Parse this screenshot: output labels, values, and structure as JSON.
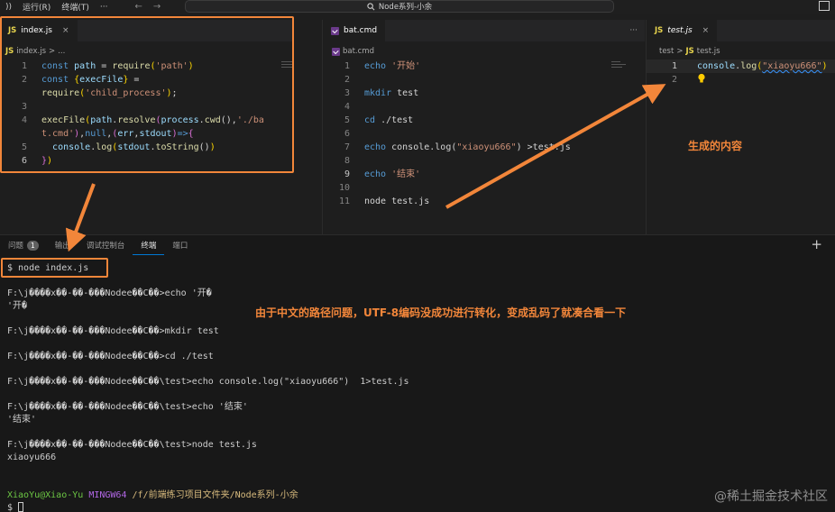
{
  "titlebar": {
    "menu": [
      "))",
      "运行(R)",
      "终端(T)",
      "···"
    ],
    "nav_back": "←",
    "nav_forward": "→",
    "search": "Node系列-小余"
  },
  "editor_left": {
    "tab_label": "index.js",
    "tab_icon": "JS",
    "tab_close": "×",
    "crumb": [
      "index.js",
      "..."
    ],
    "lines": [
      {
        "n": "1",
        "code": "const path = require('path')"
      },
      {
        "n": "2",
        "code": "const {execFile} ="
      },
      {
        "n": "",
        "code": "require('child_process');"
      },
      {
        "n": "3",
        "code": ""
      },
      {
        "n": "4",
        "code": "execFile(path.resolve(process.cwd(),'./ba"
      },
      {
        "n": "",
        "code": "t.cmd'),null,(err,stdout)=>{"
      },
      {
        "n": "5",
        "code": "  console.log(stdout.toString())"
      },
      {
        "n": "6",
        "code": "})"
      }
    ]
  },
  "editor_middle": {
    "tab_label": "bat.cmd",
    "crumb": [
      "bat.cmd"
    ],
    "actions": [
      "···"
    ],
    "lines": [
      {
        "n": "1",
        "code": "echo '开始'"
      },
      {
        "n": "2",
        "code": ""
      },
      {
        "n": "3",
        "code": "mkdir test"
      },
      {
        "n": "4",
        "code": ""
      },
      {
        "n": "5",
        "code": "cd ./test"
      },
      {
        "n": "6",
        "code": ""
      },
      {
        "n": "7",
        "code": "echo console.log(\"xiaoyu666\") >test.js"
      },
      {
        "n": "8",
        "code": ""
      },
      {
        "n": "9",
        "code": "echo '结束'"
      },
      {
        "n": "10",
        "code": ""
      },
      {
        "n": "11",
        "code": "node test.js"
      }
    ]
  },
  "editor_right": {
    "tab_label": "test.js",
    "tab_icon": "JS",
    "tab_close": "×",
    "crumb": [
      "test",
      ">",
      "JS",
      "test.js"
    ],
    "lines": [
      {
        "n": "1",
        "code": "console.log(\"xiaoyu666\")"
      },
      {
        "n": "2",
        "code": ""
      }
    ]
  },
  "annotations": {
    "generated": "生成的内容",
    "encoding": "由于中文的路径问题，UTF-8编码没成功进行转化，变成乱码了就凑合看一下"
  },
  "panel": {
    "tabs": [
      {
        "label": "问题",
        "badge": "1"
      },
      {
        "label": "输出"
      },
      {
        "label": "调试控制台"
      },
      {
        "label": "终端"
      },
      {
        "label": "端口"
      }
    ],
    "add": "+"
  },
  "terminal": {
    "command": "$ node index.js",
    "lines": [
      "",
      "F:\\j����x��-��-���Nodee��C��>echo '开�",
      "'开�",
      "",
      "F:\\j����x��-��-���Nodee��C��>mkdir test",
      "",
      "F:\\j����x��-��-���Nodee��C��>cd ./test",
      "",
      "F:\\j����x��-��-���Nodee��C��\\test>echo console.log(\"xiaoyu666\")  1>test.js",
      "",
      "F:\\j����x��-��-���Nodee��C��\\test>echo '结束'",
      "'结束'",
      "",
      "F:\\j����x��-��-���Nodee��C��\\test>node test.js",
      "xiaoyu666",
      "",
      ""
    ],
    "prompt_user": "XiaoYu@Xiao-Yu",
    "prompt_host": "MINGW64",
    "prompt_path": "/f/前端练习项目文件夹/Node系列-小余",
    "prompt_symbol": "$"
  },
  "watermark": "@稀土掘金技术社区",
  "colors": {
    "highlight": "#f2863a",
    "background": "#1e1e1e",
    "terminal_bg": "#181818"
  }
}
